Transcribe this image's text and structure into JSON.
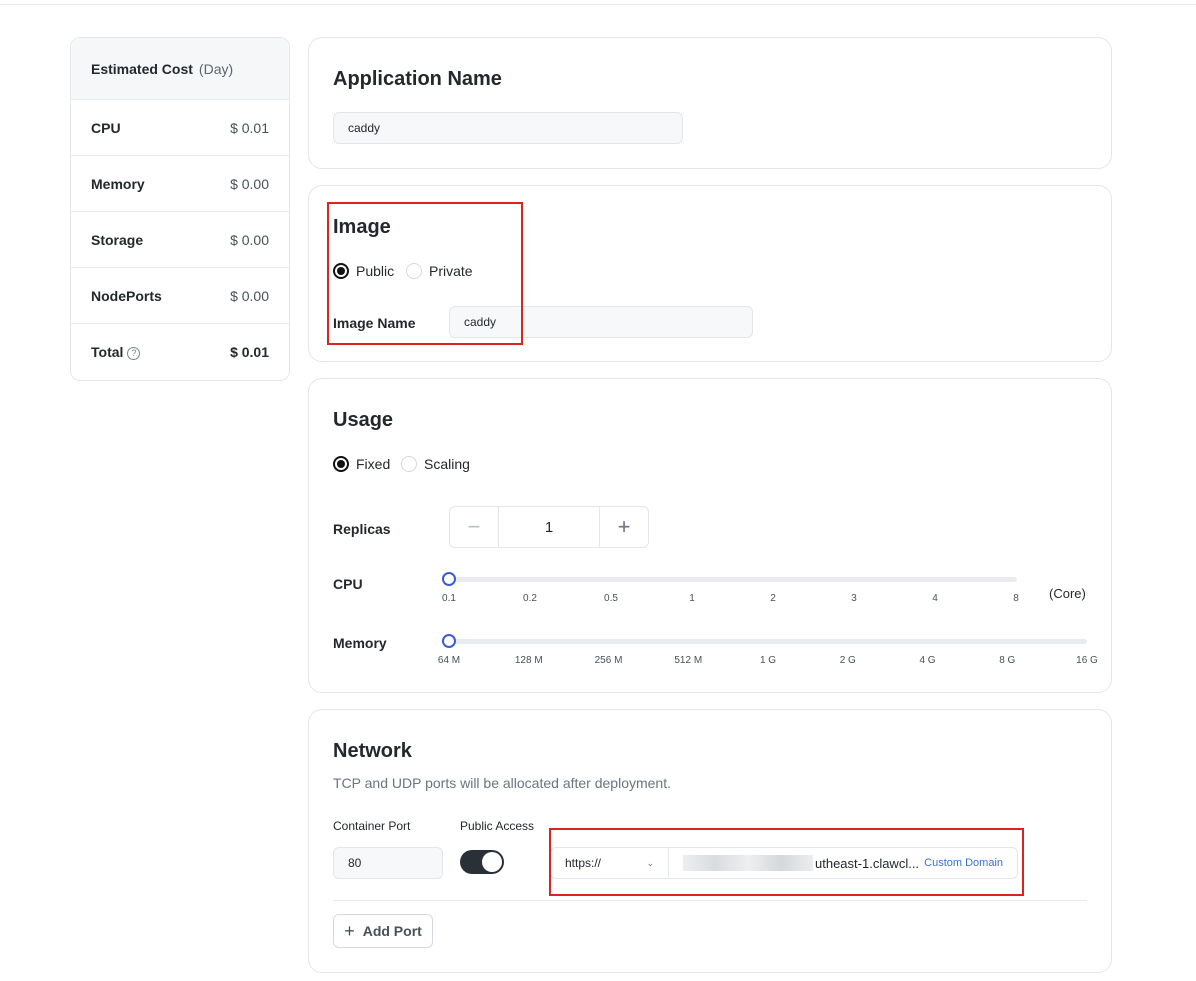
{
  "cost": {
    "title": "Estimated Cost",
    "period": "(Day)",
    "rows": [
      {
        "label": "CPU",
        "value": "$ 0.01"
      },
      {
        "label": "Memory",
        "value": "$ 0.00"
      },
      {
        "label": "Storage",
        "value": "$ 0.00"
      },
      {
        "label": "NodePorts",
        "value": "$ 0.00"
      }
    ],
    "total_label": "Total",
    "total_value": "$ 0.01",
    "help_icon": "question-circle-icon"
  },
  "app": {
    "title": "Application Name",
    "name_value": "caddy"
  },
  "image": {
    "title": "Image",
    "public_label": "Public",
    "private_label": "Private",
    "selected": "Public",
    "name_label": "Image Name",
    "name_value": "caddy"
  },
  "usage": {
    "title": "Usage",
    "fixed_label": "Fixed",
    "scaling_label": "Scaling",
    "selected": "Fixed",
    "replicas_label": "Replicas",
    "replicas_value": "1",
    "minus_symbol": "−",
    "plus_symbol": "+",
    "cpu_label": "CPU",
    "cpu_ticks": [
      "0.1",
      "0.2",
      "0.5",
      "1",
      "2",
      "3",
      "4",
      "8"
    ],
    "cpu_unit": "(Core)",
    "cpu_selected": "0.1",
    "memory_label": "Memory",
    "memory_ticks": [
      "64 M",
      "128 M",
      "256 M",
      "512 M",
      "1 G",
      "2 G",
      "4 G",
      "8 G",
      "16 G"
    ],
    "memory_selected": "64 M"
  },
  "network": {
    "title": "Network",
    "subtitle": "TCP and UDP ports will be allocated after deployment.",
    "container_port_label": "Container Port",
    "public_access_label": "Public Access",
    "port_value": "80",
    "public_access_on": true,
    "protocol": "https://",
    "domain_visible": "utheast-1.clawcl...",
    "custom_domain_label": "Custom Domain",
    "add_port_label": "Add Port"
  },
  "colors": {
    "accent": "#3a5cd6",
    "highlight_box": "#d8261e",
    "link": "#3a6fd8"
  }
}
